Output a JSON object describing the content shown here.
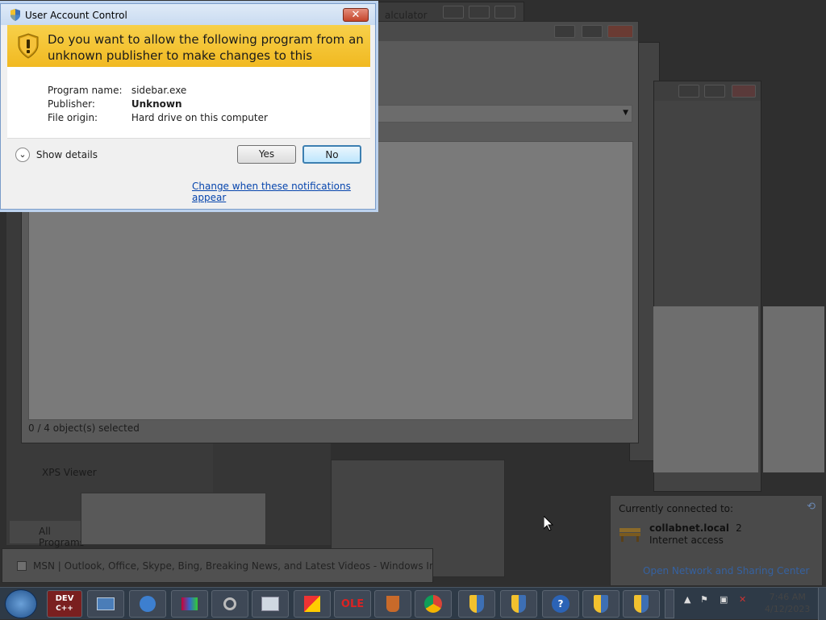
{
  "uac": {
    "title": "User Account Control",
    "question_line1": "Do you want to allow the following program from an",
    "question_line2": "unknown publisher to make changes to this computer?",
    "rows": [
      {
        "label": "Program name:",
        "value": "sidebar.exe"
      },
      {
        "label": "Publisher:",
        "value": "Unknown"
      },
      {
        "label": "File origin:",
        "value": "Hard drive on this computer"
      }
    ],
    "show_details": "Show details",
    "yes_label": "Yes",
    "no_label": "No",
    "change_link": "Change when these notifications appear",
    "close_glyph": "✕"
  },
  "background": {
    "calculator_title_fragment": "alculator",
    "explorer_status": "0 / 4 object(s) selected",
    "msn_item": "MSN | Outlook, Office, Skype, Bing, Breaking News, and Latest Videos - Windows Internet E...",
    "start_menu_items": [
      "XPS Viewer",
      "All Programs"
    ]
  },
  "network_popup": {
    "header": "Currently connected to:",
    "network_name": "collabnet.local",
    "network_number": "2",
    "network_status": "Internet access",
    "open_link": "Open Network and Sharing Center"
  },
  "taskbar": {
    "icons": [
      "start-orb",
      "dev-cpp",
      "remote-desktop",
      "internet-explorer",
      "media-center",
      "magnifier",
      "vmware",
      "paint",
      "ole-viewer",
      "java",
      "chrome",
      "uac-shield",
      "uac-shield",
      "help",
      "uac-shield",
      "uac-shield"
    ],
    "dev_label": "DEV",
    "dev_sub": "C++",
    "ole_label": "OLE",
    "help_glyph": "?",
    "clock_time": "7:46 AM",
    "clock_date": "4/12/2023"
  },
  "colors": {
    "uac_banner": "#f3c52e",
    "taskbar": "#2e3a47",
    "link": "#0645ad"
  }
}
